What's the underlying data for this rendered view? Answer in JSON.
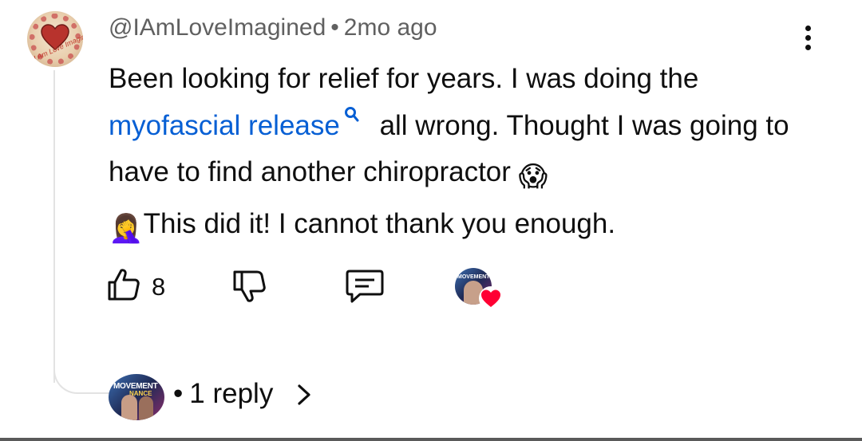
{
  "comment": {
    "author": "@IAmLoveImagined",
    "separator": "•",
    "time_ago": "2mo ago",
    "text_part1": "Been looking for relief for years. I was doing the",
    "search_link": "myofascial release",
    "text_part2": " all wrong. Thought I was going to have to find another chiropractor",
    "text_part3": "This did it! I cannot thank you enough.",
    "emoji_scream": "😱",
    "emoji_facepalm": "🤦‍♀️",
    "avatar_text": "I Am Love Imagined"
  },
  "actions": {
    "like_count": "8"
  },
  "creator_avatar_text": "MOVEMENT",
  "replies": {
    "separator": "•",
    "label": "1 reply",
    "avatar_text_1": "MOVEMENT",
    "avatar_text_2": "NANCE"
  },
  "colors": {
    "link": "#065fd4",
    "heart": "#ff0033",
    "meta": "#606060"
  },
  "icons": [
    "more-vert-icon",
    "search-icon",
    "thumb-up-icon",
    "thumb-down-icon",
    "reply-comment-icon",
    "heart-icon",
    "chevron-right-icon"
  ]
}
